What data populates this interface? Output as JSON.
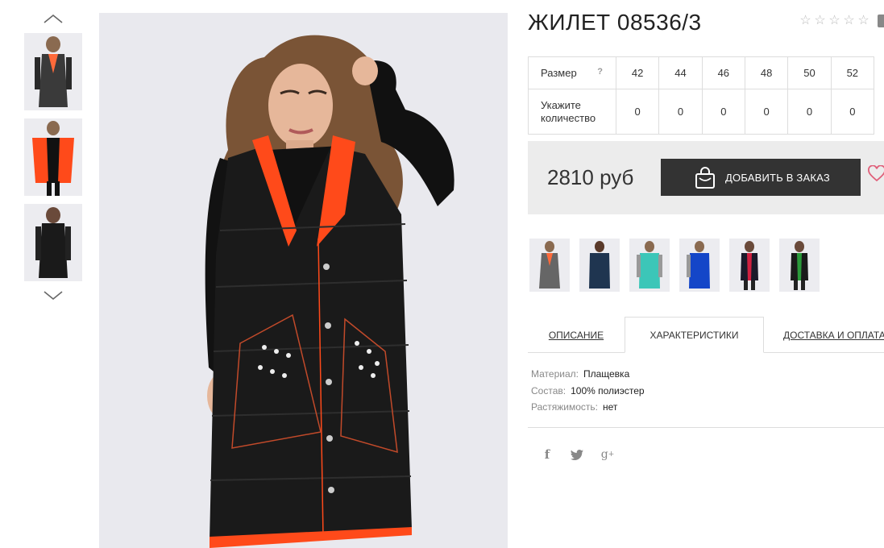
{
  "product": {
    "title": "ЖИЛЕТ 08536/3",
    "rating_stars": 5
  },
  "sizes": {
    "size_label": "Размер",
    "help_mark": "?",
    "quantity_label_line1": "Укажите",
    "quantity_label_line2": "количество",
    "values": [
      "42",
      "44",
      "46",
      "48",
      "50",
      "52"
    ],
    "quantities": [
      "0",
      "0",
      "0",
      "0",
      "0",
      "0"
    ]
  },
  "buy": {
    "price": "2810 руб",
    "add_button": "ДОБАВИТЬ В ЗАКАЗ"
  },
  "tabs": [
    {
      "label": "ОПИСАНИЕ",
      "active": false
    },
    {
      "label": "ХАРАКТЕРИСТИКИ",
      "active": true
    },
    {
      "label": "ДОСТАВКА И ОПЛАТА",
      "active": false
    }
  ],
  "specs": [
    {
      "label": "Материал:",
      "value": "Плащевка"
    },
    {
      "label": "Состав:",
      "value": "100% полиэстер"
    },
    {
      "label": "Растяжимость:",
      "value": "нет"
    }
  ],
  "social": [
    "facebook-icon",
    "twitter-icon",
    "google-plus-icon"
  ],
  "colors": {
    "vest_black": "#1a1a1a",
    "lining_orange": "#ff4a1a",
    "button_bg": "#333333",
    "buy_box_bg": "#ececec",
    "heart": "#e0607a"
  },
  "variants": [
    "gray",
    "navy",
    "turquoise",
    "blue",
    "black-red",
    "black-green"
  ]
}
